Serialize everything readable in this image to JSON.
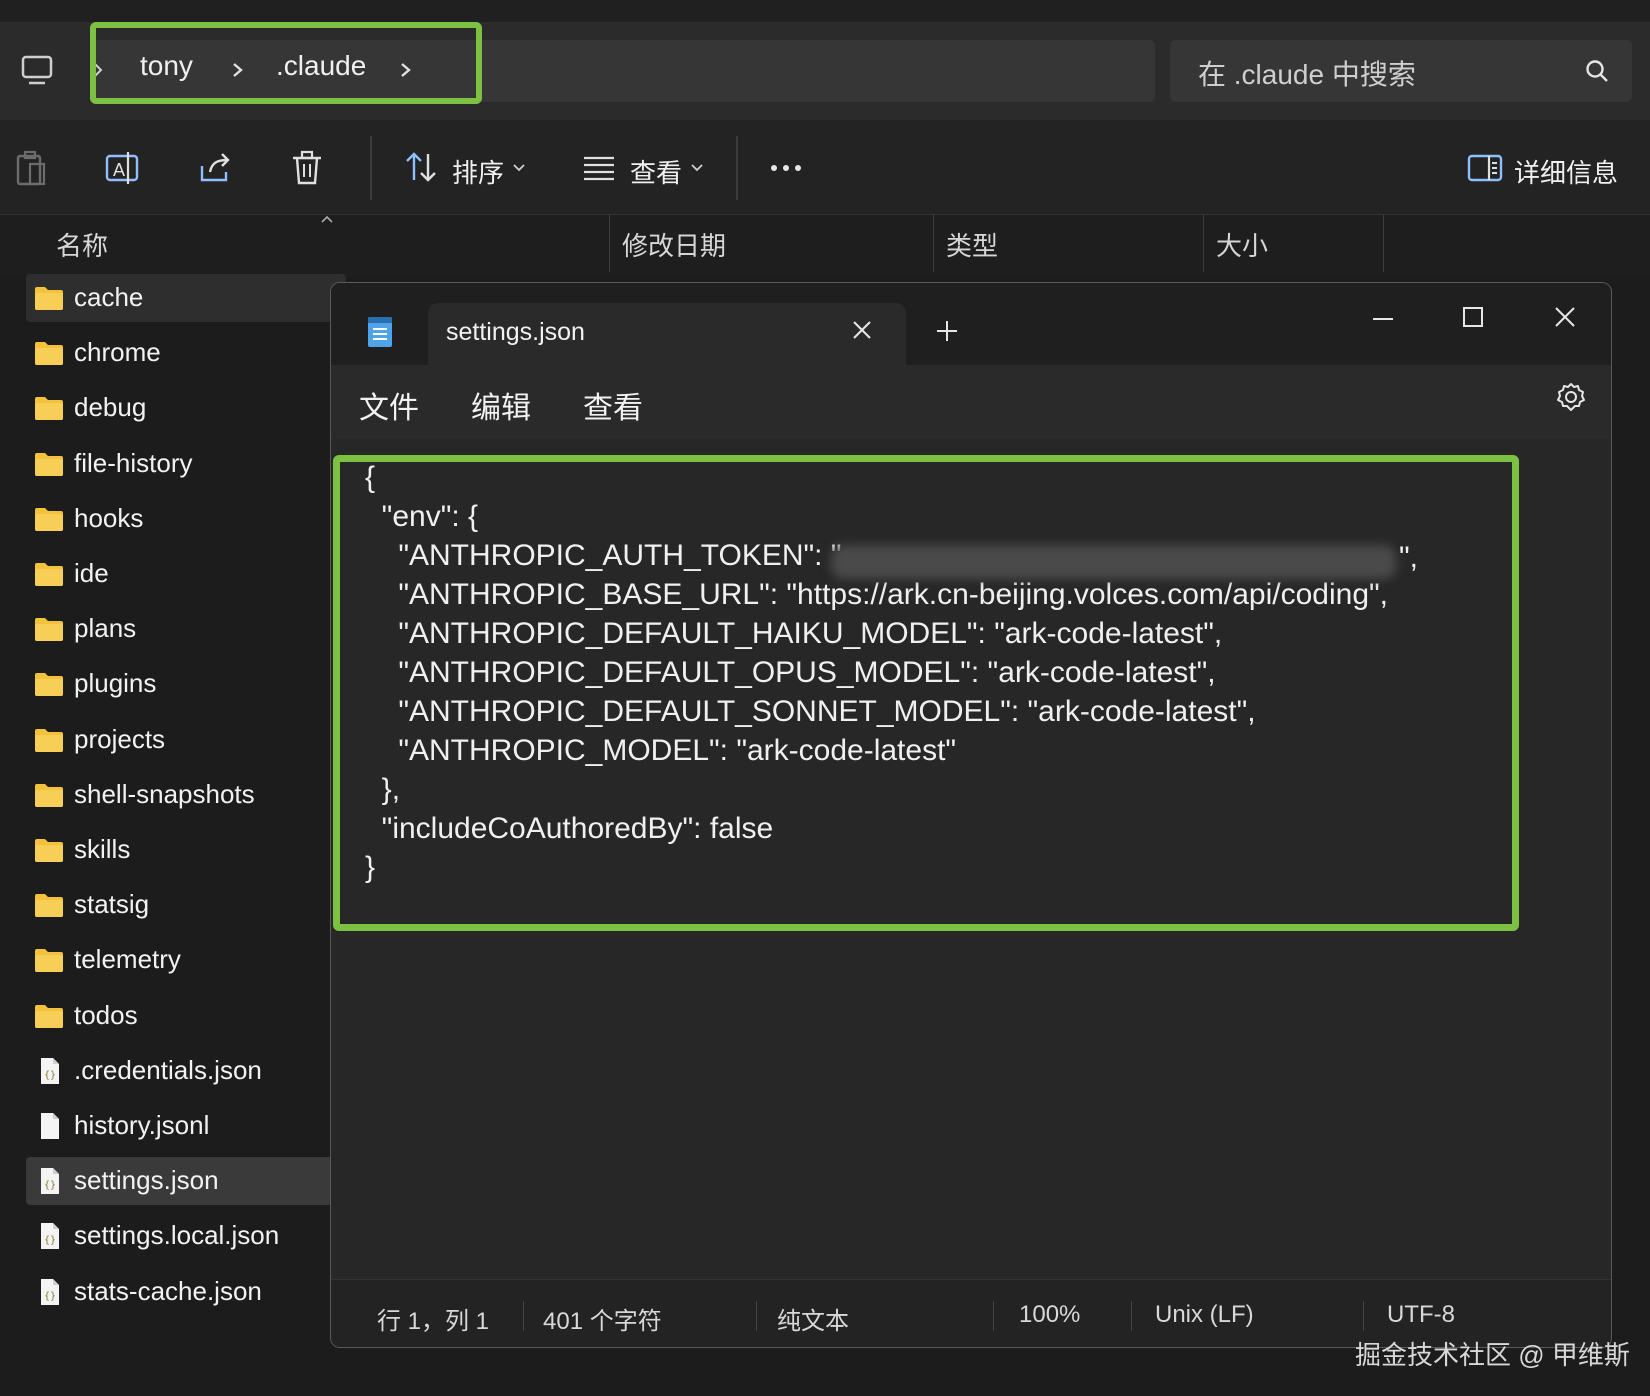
{
  "explorer": {
    "breadcrumb": [
      "tony",
      ".claude"
    ],
    "search_placeholder": "在 .claude 中搜索",
    "toolbar": {
      "sort_label": "排序",
      "view_label": "查看",
      "details_label": "详细信息"
    },
    "columns": [
      "名称",
      "修改日期",
      "类型",
      "大小"
    ],
    "files": [
      {
        "name": "cache",
        "kind": "folder"
      },
      {
        "name": "chrome",
        "kind": "folder"
      },
      {
        "name": "debug",
        "kind": "folder"
      },
      {
        "name": "file-history",
        "kind": "folder"
      },
      {
        "name": "hooks",
        "kind": "folder"
      },
      {
        "name": "ide",
        "kind": "folder"
      },
      {
        "name": "plans",
        "kind": "folder"
      },
      {
        "name": "plugins",
        "kind": "folder"
      },
      {
        "name": "projects",
        "kind": "folder"
      },
      {
        "name": "shell-snapshots",
        "kind": "folder"
      },
      {
        "name": "skills",
        "kind": "folder"
      },
      {
        "name": "statsig",
        "kind": "folder"
      },
      {
        "name": "telemetry",
        "kind": "folder"
      },
      {
        "name": "todos",
        "kind": "folder"
      },
      {
        "name": ".credentials.json",
        "kind": "json"
      },
      {
        "name": "history.jsonl",
        "kind": "file"
      },
      {
        "name": "settings.json",
        "kind": "json"
      },
      {
        "name": "settings.local.json",
        "kind": "json"
      },
      {
        "name": "stats-cache.json",
        "kind": "json"
      }
    ]
  },
  "notepad": {
    "tab_title": "settings.json",
    "menu": [
      "文件",
      "编辑",
      "查看"
    ],
    "code_lines": [
      "{",
      "  \"env\": {",
      "    \"ANTHROPIC_AUTH_TOKEN\": \"",
      "    \"ANTHROPIC_BASE_URL\": \"https://ark.cn-beijing.volces.com/api/coding\",",
      "    \"ANTHROPIC_DEFAULT_HAIKU_MODEL\": \"ark-code-latest\",",
      "    \"ANTHROPIC_DEFAULT_OPUS_MODEL\": \"ark-code-latest\",",
      "    \"ANTHROPIC_DEFAULT_SONNET_MODEL\": \"ark-code-latest\",",
      "    \"ANTHROPIC_MODEL\": \"ark-code-latest\"",
      "  },",
      "  \"includeCoAuthoredBy\": false",
      "}"
    ],
    "token_suffix": "\",",
    "status": {
      "position": "行 1，列 1",
      "chars": "401 个字符",
      "format": "纯文本",
      "zoom": "100%",
      "line_ending": "Unix (LF)",
      "encoding": "UTF-8"
    }
  },
  "watermark": "掘金技术社区 @ 甲维斯",
  "colors": {
    "highlight": "#7dc142",
    "folder": "#f3c13a",
    "background": "#1c1c1c"
  }
}
